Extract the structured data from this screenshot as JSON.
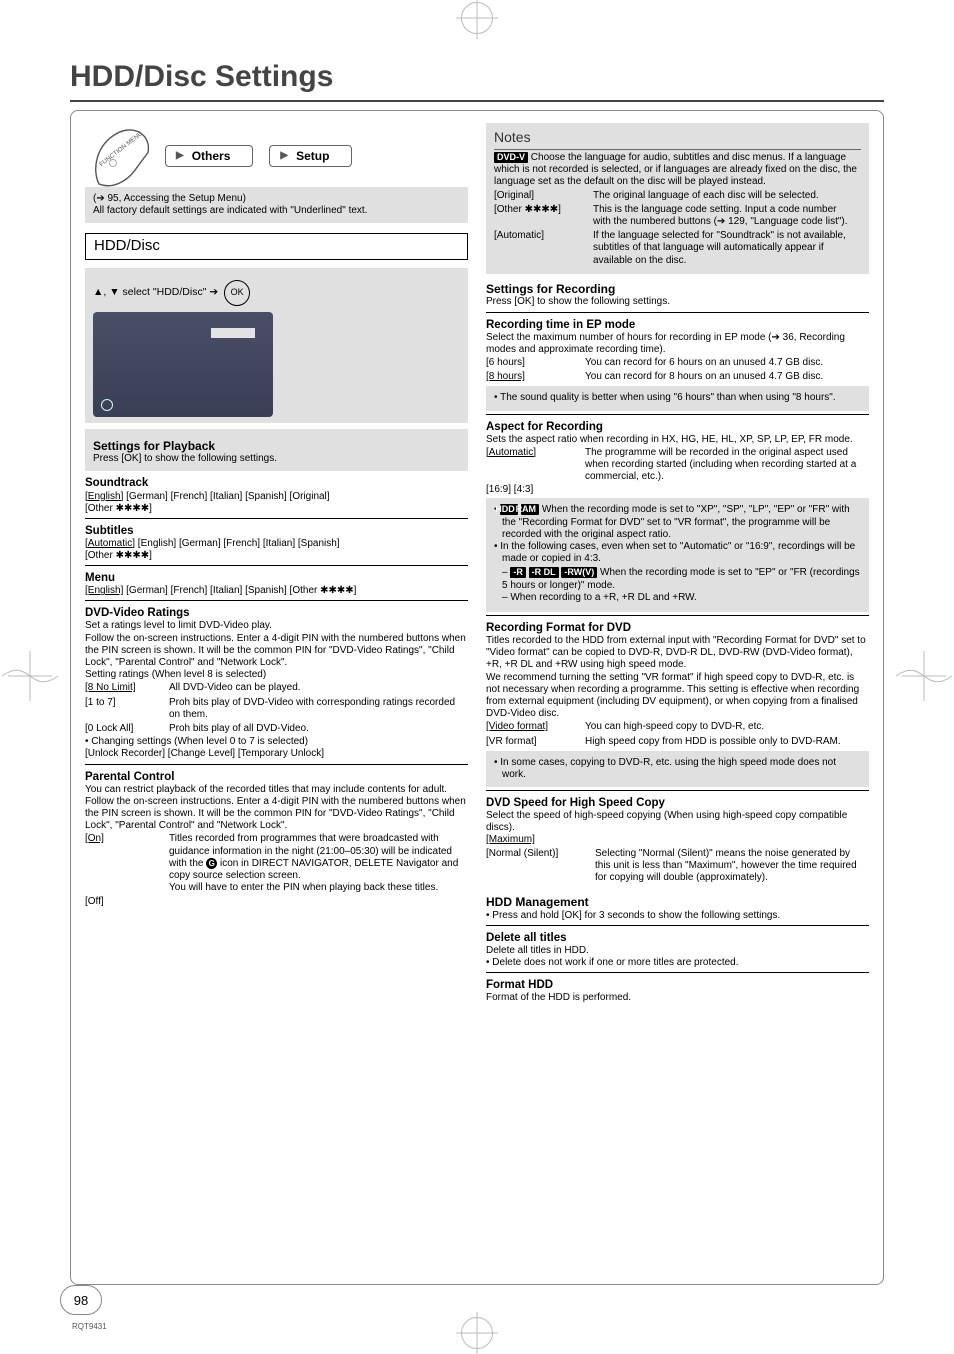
{
  "page_title": "HDD/Disc Settings",
  "remote_menu": {
    "others": "Others",
    "setup": "Setup"
  },
  "access_note": "(➔ 95, Accessing the Setup Menu)",
  "factory_note": "All factory default settings are indicated with \"Underlined\" text.",
  "hdd_disc_heading": "HDD/Disc",
  "select_prefix": "▲, ▼ select \"HDD/Disc\" ➔",
  "ok_label": "OK",
  "settings_playback": {
    "heading": "Settings for Playback",
    "sub": "Press [OK] to show the following settings."
  },
  "soundtrack": {
    "heading": "Soundtrack",
    "line": "[English] [German] [French] [Italian] [Spanish] [Original]\n[Other ✱✱✱✱]"
  },
  "subtitles": {
    "heading": "Subtitles",
    "line": "[Automatic] [English] [German] [French] [Italian] [Spanish]\n[Other ✱✱✱✱]"
  },
  "menu": {
    "heading": "Menu",
    "line": "[English] [German] [French] [Italian] [Spanish] [Other ✱✱✱✱]"
  },
  "dvd_ratings": {
    "heading": "DVD-Video Ratings",
    "body": "Set a ratings level to limit DVD-Video play.\nFollow the on-screen instructions. Enter a 4-digit PIN with the numbered buttons when the PIN screen is shown. It will be the common PIN for \"DVD-Video Ratings\", \"Child Lock\", \"Parental Control\" and \"Network Lock\".",
    "setting8": "Setting ratings (When level 8 is selected)",
    "rows8": [
      {
        "k": "[8 No Limit]",
        "v": "All DVD-Video can be played."
      },
      {
        "k": "[1 to 7]",
        "v": "Proh bits play of DVD-Video with corresponding ratings recorded on them."
      },
      {
        "k": "[0 Lock All]",
        "v": "Proh bits play of all DVD-Video."
      }
    ],
    "changing": "• Changing settings (When level 0 to 7 is selected)",
    "changing_opts": "[Unlock Recorder]   [Change Level]   [Temporary Unlock]"
  },
  "parental": {
    "heading": "Parental Control",
    "body": "You can restrict playback of the recorded titles that may include contents for adult. Follow the on-screen instructions. Enter a 4-digit PIN with the numbered buttons when the PIN screen is shown. It will be the common PIN for \"DVD-Video Ratings\", \"Child Lock\", \"Parental Control\" and \"Network Lock\".",
    "on_k": "[On]",
    "on_v_pre": "Titles recorded from programmes that were broadcasted with guidance information in the night (21:00–05:30) will be indicated with the ",
    "on_v_post": " icon in DIRECT NAVIGATOR, DELETE Navigator and copy source selection screen.\nYou will have to enter the PIN when playing back these titles.",
    "off_k": "[Off]"
  },
  "notes": {
    "heading": "Notes",
    "dvdv_body": " Choose the language for audio, subtitles and disc menus. If a language which is not recorded is selected, or if languages are already fixed on the disc, the language set as the default on the disc will be played instead.",
    "rows": [
      {
        "k": "[Original]",
        "v": "The original language of each disc will be selected."
      },
      {
        "k": "[Other ✱✱✱✱]",
        "v": "This is the language code setting. Input a code number with the numbered buttons (➔ 129, \"Language code list\")."
      },
      {
        "k": "[Automatic]",
        "v": "If the language selected for \"Soundtrack\" is not available, subtitles of that language will automatically appear if available on the disc."
      }
    ]
  },
  "settings_recording": {
    "heading": "Settings for Recording",
    "sub": "Press [OK] to show the following settings."
  },
  "rec_time_ep": {
    "heading": "Recording time in EP mode",
    "body": "Select the maximum number of hours for recording in EP mode (➔ 36, Recording modes and approximate recording time).",
    "rows": [
      {
        "k": "[6 hours]",
        "v": "You can record for 6 hours on an unused 4.7 GB disc."
      },
      {
        "k": "[8 hours]",
        "v": "You can record for 8 hours on an unused 4.7 GB disc."
      }
    ],
    "note": "• The sound quality is better when using \"6 hours\" than when using \"8 hours\"."
  },
  "aspect": {
    "heading": "Aspect for Recording",
    "body": "Sets the aspect ratio when recording in HX, HG, HE, HL, XP, SP, LP, EP, FR mode.",
    "rows": [
      {
        "k": "[Automatic]",
        "v": "The programme will be recorded in the original aspect used when recording started (including when recording started at a commercial, etc.)."
      }
    ],
    "extra": "[16:9]        [4:3]",
    "note1_pre": "• ",
    "note1_badges": [
      "HDD",
      "RAM"
    ],
    "note1": " When the recording mode is set to \"XP\", \"SP\", \"LP\", \"EP\" or \"FR\" with the \"Recording Format for DVD\" set to \"VR format\", the programme will be recorded with the original aspect ratio.",
    "note2": "• In the following cases, even when set to \"Automatic\" or \"16:9\", recordings will be made or copied in 4:3.",
    "dash1_badges": [
      "-R",
      "-R DL",
      "-RW(V)"
    ],
    "dash1": " When the recording mode is set to \"EP\" or \"FR (recordings 5 hours or longer)\" mode.",
    "dash2": "When recording to a +R, +R DL and +RW."
  },
  "rec_fmt_dvd": {
    "heading": "Recording Format for DVD",
    "body": "Titles recorded to the HDD from external input with \"Recording Format for DVD\" set to \"Video format\" can be copied to DVD-R, DVD-R DL, DVD-RW (DVD-Video format), +R, +R DL and +RW using high speed mode.\nWe recommend turning the setting \"VR format\" if high speed copy to DVD-R, etc. is not necessary when recording a programme. This setting is effective when recording from external equipment (including DV equipment), or when copying from a finalised DVD-Video disc.",
    "rows": [
      {
        "k": "[Video format]",
        "v": "You can high-speed copy to DVD-R, etc."
      },
      {
        "k": "[VR format]",
        "v": "High speed copy from HDD is possible only to DVD-RAM."
      }
    ],
    "note": "• In some cases, copying to DVD-R, etc. using the high speed mode does not work."
  },
  "dvd_speed": {
    "heading": "DVD Speed for High Speed Copy",
    "body": "Select the speed of high-speed copying (When using high-speed copy compatible discs).",
    "max": "[Maximum]",
    "normal_k": "[Normal (Silent)]",
    "normal_v": "Selecting \"Normal (Silent)\" means the noise generated by this unit is less than \"Maximum\", however the time required for copying will double (approximately)."
  },
  "hdd_mgmt": {
    "heading": "HDD Management",
    "body": "• Press and hold [OK] for 3 seconds to show the following settings."
  },
  "del_titles": {
    "heading": "Delete all titles",
    "body": "Delete all titles in HDD.",
    "note": "• Delete does not work if one or more titles are protected."
  },
  "format_hdd": {
    "heading": "Format HDD",
    "body": "Format of the HDD is performed."
  },
  "page_number": "98",
  "footer_code": "RQT9431"
}
